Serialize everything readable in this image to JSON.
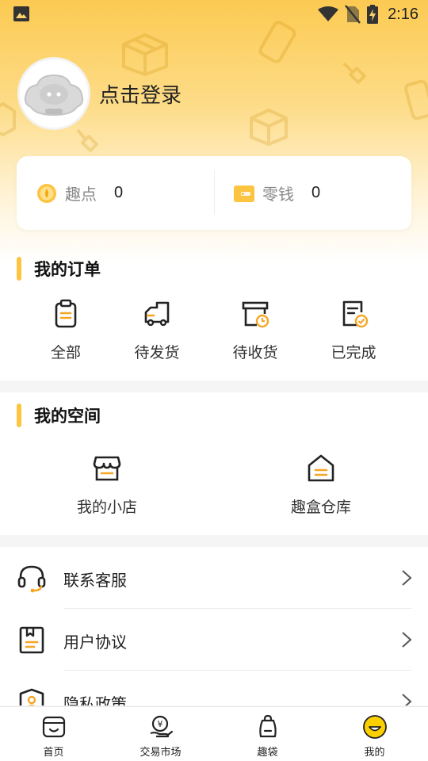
{
  "status_bar": {
    "time": "2:16"
  },
  "profile": {
    "login_text": "点击登录"
  },
  "balance": {
    "points": {
      "label": "趣点",
      "value": "0"
    },
    "change": {
      "label": "零钱",
      "value": "0"
    }
  },
  "orders": {
    "title": "我的订单",
    "items": [
      {
        "label": "全部",
        "icon": "clipboard-icon"
      },
      {
        "label": "待发货",
        "icon": "truck-icon"
      },
      {
        "label": "待收货",
        "icon": "box-clock-icon"
      },
      {
        "label": "已完成",
        "icon": "document-check-icon"
      }
    ]
  },
  "space": {
    "title": "我的空间",
    "items": [
      {
        "label": "我的小店",
        "icon": "shop-icon"
      },
      {
        "label": "趣盒仓库",
        "icon": "warehouse-icon"
      }
    ]
  },
  "menu": [
    {
      "label": "联系客服",
      "icon": "headset-icon"
    },
    {
      "label": "用户协议",
      "icon": "agreement-icon"
    },
    {
      "label": "隐私政策",
      "icon": "privacy-shield-icon"
    }
  ],
  "tabs": [
    {
      "label": "首页",
      "icon": "home-box-icon"
    },
    {
      "label": "交易市场",
      "icon": "market-coin-icon"
    },
    {
      "label": "趣袋",
      "icon": "bag-icon"
    },
    {
      "label": "我的",
      "icon": "profile-smile-icon",
      "active": true
    }
  ],
  "colors": {
    "accent": "#fcc441",
    "accent_dark": "#f5a623",
    "text": "#222222"
  }
}
